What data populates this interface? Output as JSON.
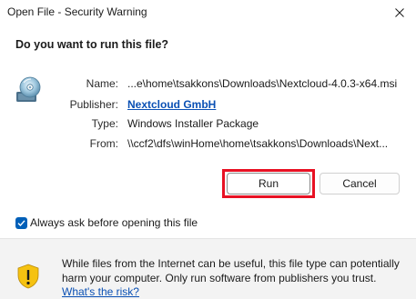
{
  "window": {
    "title": "Open File - Security Warning",
    "close_icon": "close-icon"
  },
  "prompt": {
    "question": "Do you want to run this file?"
  },
  "file_info": {
    "icon": "installer-disc-icon",
    "name_label": "Name:",
    "name_value": "...e\\home\\tsakkons\\Downloads\\Nextcloud-4.0.3-x64.msi",
    "publisher_label": "Publisher:",
    "publisher_value": "Nextcloud GmbH",
    "type_label": "Type:",
    "type_value": "Windows Installer Package",
    "from_label": "From:",
    "from_value": "\\\\ccf2\\dfs\\winHome\\home\\tsakkons\\Downloads\\Next..."
  },
  "buttons": {
    "run_label": "Run",
    "cancel_label": "Cancel"
  },
  "checkbox": {
    "label": "Always ask before opening this file",
    "checked": true
  },
  "footer": {
    "icon": "shield-warning-icon",
    "warning_text": "While files from the Internet can be useful, this file type can potentially harm your computer. Only run software from publishers you trust.",
    "risk_link": "What's the risk?"
  },
  "colors": {
    "highlight": "#e81123",
    "link": "#0a50b4",
    "checkbox": "#005fb8",
    "shield": "#f5c211"
  }
}
